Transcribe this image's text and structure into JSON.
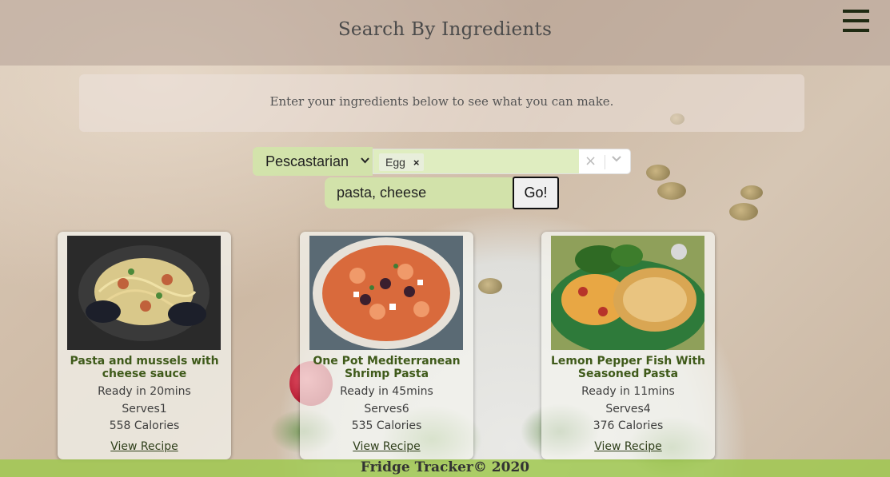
{
  "header": {
    "title": "Search By Ingredients",
    "menu_icon": "hamburger-menu-icon"
  },
  "intro": {
    "text": "Enter your ingredients below to see what you can make."
  },
  "search": {
    "diet_selected": "Pescastarian",
    "selected_ingredients": [
      {
        "label": "Egg",
        "remove_symbol": "×"
      }
    ],
    "clear_symbol": "×",
    "dropdown_symbol": "⌄",
    "text_value": "pasta, cheese",
    "go_label": "Go!"
  },
  "recipes": [
    {
      "name": "Pasta and mussels with cheese sauce",
      "ready": "Ready in 20mins",
      "serves": "Serves1",
      "calories": "558 Calories",
      "link": "View Recipe"
    },
    {
      "name": "One Pot Mediterranean Shrimp Pasta",
      "ready": "Ready in 45mins",
      "serves": "Serves6",
      "calories": "535 Calories",
      "link": "View Recipe"
    },
    {
      "name": "Lemon Pepper Fish With Seasoned Pasta",
      "ready": "Ready in 11mins",
      "serves": "Serves4",
      "calories": "376 Calories",
      "link": "View Recipe"
    }
  ],
  "footer": {
    "text": "Fridge Tracker© 2020"
  },
  "colors": {
    "accent_green": "#a0c850",
    "card_title": "#3f5a1a",
    "input_bg": "#d2e4aa"
  }
}
